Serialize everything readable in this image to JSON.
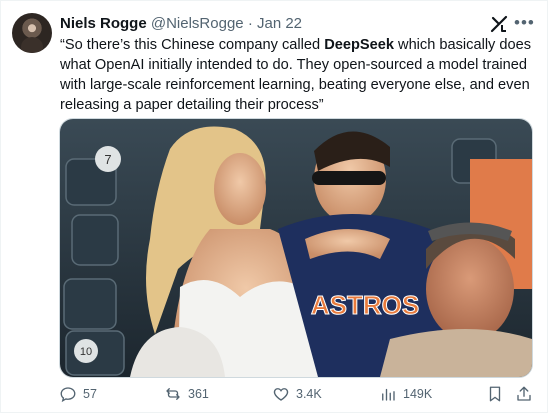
{
  "author": {
    "name": "Niels Rogge",
    "handle": "@NielsRogge",
    "separator": "·",
    "date": "Jan 22"
  },
  "tweet": {
    "text_before": "“So there’s this Chinese company called ",
    "text_bold": "DeepSeek",
    "text_after": " which basically does what OpenAI initially intended to do. They open-sourced a model trained with large-scale reinforcement learning, beating everyone else, and even releasing a paper detailing their process”"
  },
  "media": {
    "shirt_text": "ASTROS",
    "seat_number_1": "7",
    "seat_number_2": "10"
  },
  "actions": {
    "replies": "57",
    "reposts": "361",
    "likes": "3.4K",
    "views": "149K"
  },
  "icons": [
    "grok-icon",
    "more-icon",
    "reply-icon",
    "repost-icon",
    "like-icon",
    "views-icon",
    "bookmark-icon",
    "share-icon"
  ],
  "colors": {
    "text": "#0f1419",
    "muted": "#536471",
    "border": "#cfd9de"
  }
}
